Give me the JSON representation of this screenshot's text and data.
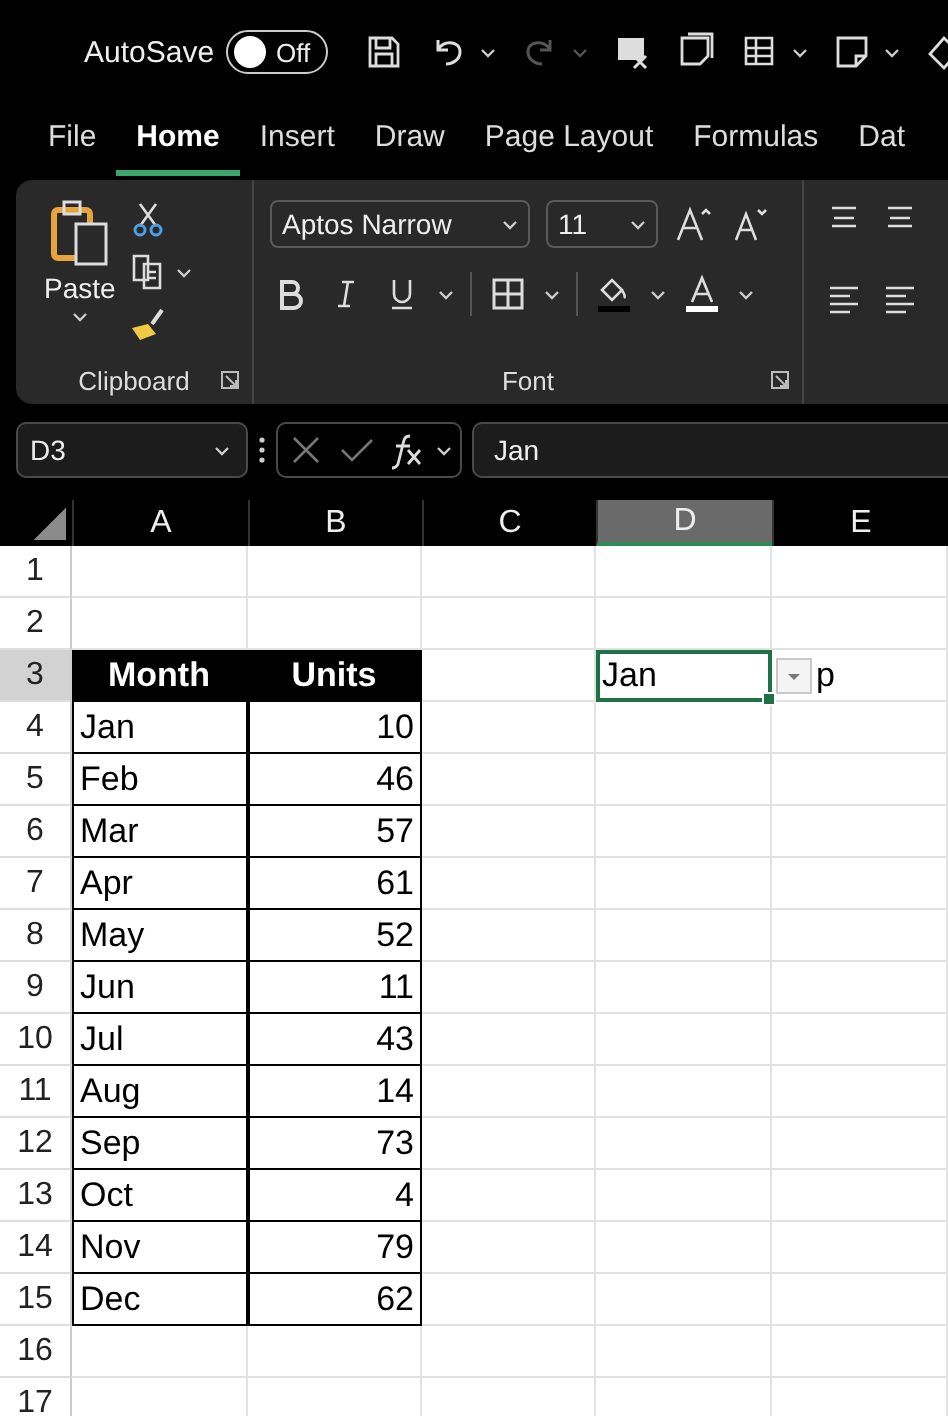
{
  "title_bar": {
    "autosave_label": "AutoSave",
    "autosave_on": false,
    "autosave_state": "Off"
  },
  "tabs": [
    {
      "label": "File",
      "selected": false
    },
    {
      "label": "Home",
      "selected": true
    },
    {
      "label": "Insert",
      "selected": false
    },
    {
      "label": "Draw",
      "selected": false
    },
    {
      "label": "Page Layout",
      "selected": false
    },
    {
      "label": "Formulas",
      "selected": false
    },
    {
      "label": "Dat",
      "selected": false
    }
  ],
  "ribbon": {
    "paste_label": "Paste",
    "clipboard_label": "Clipboard",
    "font_name": "Aptos Narrow",
    "font_size": "11",
    "font_label": "Font"
  },
  "formula_bar": {
    "name_box": "D3",
    "value": "Jan"
  },
  "columns": [
    {
      "label": "A",
      "selected": false
    },
    {
      "label": "B",
      "selected": false
    },
    {
      "label": "C",
      "selected": false
    },
    {
      "label": "D",
      "selected": true
    },
    {
      "label": "E",
      "selected": false
    }
  ],
  "rows": [
    {
      "number": "1",
      "selected": false,
      "kind": "blank"
    },
    {
      "number": "2",
      "selected": false,
      "kind": "blank"
    },
    {
      "number": "3",
      "selected": true,
      "kind": "table-header",
      "cells": {
        "A": "Month",
        "B": "Units",
        "D": "Jan",
        "E": "p"
      }
    },
    {
      "number": "4",
      "selected": false,
      "kind": "table-row",
      "cells": {
        "A": "Jan",
        "B": "10"
      }
    },
    {
      "number": "5",
      "selected": false,
      "kind": "table-row",
      "cells": {
        "A": "Feb",
        "B": "46"
      }
    },
    {
      "number": "6",
      "selected": false,
      "kind": "table-row",
      "cells": {
        "A": "Mar",
        "B": "57"
      }
    },
    {
      "number": "7",
      "selected": false,
      "kind": "table-row",
      "cells": {
        "A": "Apr",
        "B": "61"
      }
    },
    {
      "number": "8",
      "selected": false,
      "kind": "table-row",
      "cells": {
        "A": "May",
        "B": "52"
      }
    },
    {
      "number": "9",
      "selected": false,
      "kind": "table-row",
      "cells": {
        "A": "Jun",
        "B": "11"
      }
    },
    {
      "number": "10",
      "selected": false,
      "kind": "table-row",
      "cells": {
        "A": "Jul",
        "B": "43"
      }
    },
    {
      "number": "11",
      "selected": false,
      "kind": "table-row",
      "cells": {
        "A": "Aug",
        "B": "14"
      }
    },
    {
      "number": "12",
      "selected": false,
      "kind": "table-row",
      "cells": {
        "A": "Sep",
        "B": "73"
      }
    },
    {
      "number": "13",
      "selected": false,
      "kind": "table-row",
      "cells": {
        "A": "Oct",
        "B": "4"
      }
    },
    {
      "number": "14",
      "selected": false,
      "kind": "table-row",
      "cells": {
        "A": "Nov",
        "B": "79"
      }
    },
    {
      "number": "15",
      "selected": false,
      "kind": "table-row",
      "cells": {
        "A": "Dec",
        "B": "62"
      }
    },
    {
      "number": "16",
      "selected": false,
      "kind": "blank"
    },
    {
      "number": "17",
      "selected": false,
      "kind": "blank"
    }
  ]
}
